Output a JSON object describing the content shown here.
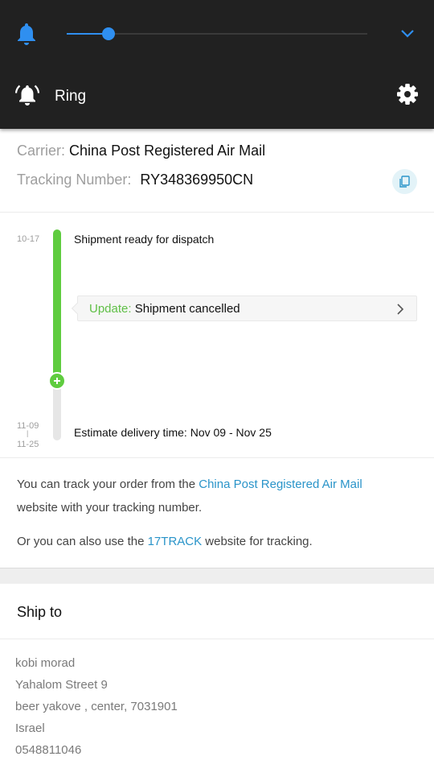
{
  "volume_panel": {
    "ringer_level_percent": 14,
    "ring_label": "Ring",
    "icons": {
      "bell": "bell-icon",
      "ring": "ring-bell-icon",
      "settings": "gear-icon",
      "expand": "chevron-down-icon"
    },
    "accent_color": "#2f8ff0"
  },
  "shipment": {
    "carrier_label": "Carrier:",
    "carrier_value": "China Post Registered Air Mail",
    "tracking_label": "Tracking Number:",
    "tracking_value": "RY348369950CN",
    "copy_icon": "copy-icon"
  },
  "timeline": {
    "start_date": "10-17",
    "start_event": "Shipment ready for dispatch",
    "update_label": "Update:",
    "update_text": "Shipment cancelled",
    "end_date_from": "11-09",
    "end_date_sep": "|",
    "end_date_to": "11-25",
    "end_event": "Estimate delivery time: Nov 09 - Nov 25",
    "progress_color": "#5fcc3f"
  },
  "info": {
    "line1_prefix": "You can track your order from the ",
    "line1_link": "China Post Registered Air Mail",
    "line2": "website with your tracking number.",
    "line3_prefix": "Or you can also use the ",
    "line3_link": "17TRACK",
    "line3_suffix": " website for tracking.",
    "link_color": "#2a94c9"
  },
  "ship_to": {
    "title": "Ship to",
    "name": "kobi morad",
    "street": "Yahalom Street 9",
    "city": "beer yakove , center, 7031901",
    "country": "Israel",
    "phone": "0548811046"
  }
}
